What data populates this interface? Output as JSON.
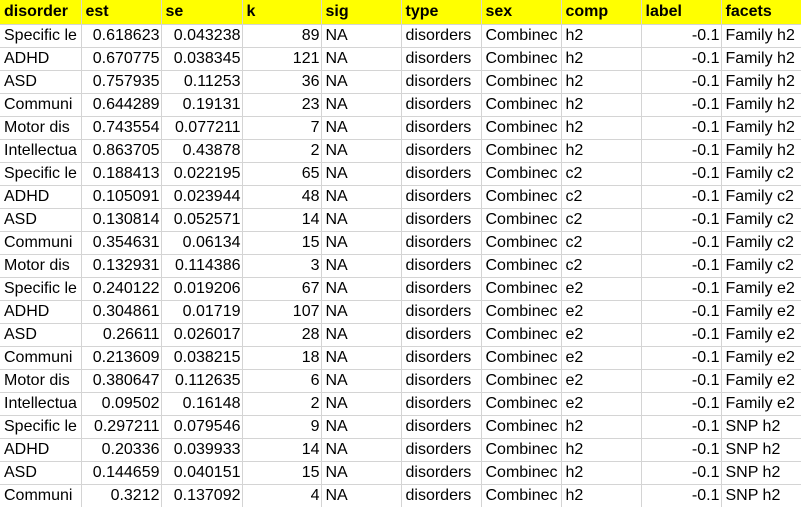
{
  "colors": {
    "header_bg": "#ffff00",
    "gridline": "#d4d4d4"
  },
  "header": {
    "disorder": "disorder",
    "est": "est",
    "se": "se",
    "k": "k",
    "sig": "sig",
    "type": "type",
    "sex": "sex",
    "comp": "comp",
    "label": "label",
    "facets": "facets"
  },
  "rows": [
    {
      "disorder": "Specific le",
      "est": "0.618623",
      "se": "0.043238",
      "k": "89",
      "sig": "NA",
      "type": "disorders",
      "sex": "Combinec",
      "comp": "h2",
      "label": "-0.1",
      "facets": "Family h2"
    },
    {
      "disorder": "ADHD",
      "est": "0.670775",
      "se": "0.038345",
      "k": "121",
      "sig": "NA",
      "type": "disorders",
      "sex": "Combinec",
      "comp": "h2",
      "label": "-0.1",
      "facets": "Family h2"
    },
    {
      "disorder": "ASD",
      "est": "0.757935",
      "se": "0.11253",
      "k": "36",
      "sig": "NA",
      "type": "disorders",
      "sex": "Combinec",
      "comp": "h2",
      "label": "-0.1",
      "facets": "Family h2"
    },
    {
      "disorder": "Communi",
      "est": "0.644289",
      "se": "0.19131",
      "k": "23",
      "sig": "NA",
      "type": "disorders",
      "sex": "Combinec",
      "comp": "h2",
      "label": "-0.1",
      "facets": "Family h2"
    },
    {
      "disorder": "Motor dis",
      "est": "0.743554",
      "se": "0.077211",
      "k": "7",
      "sig": "NA",
      "type": "disorders",
      "sex": "Combinec",
      "comp": "h2",
      "label": "-0.1",
      "facets": "Family h2"
    },
    {
      "disorder": "Intellectua",
      "est": "0.863705",
      "se": "0.43878",
      "k": "2",
      "sig": "NA",
      "type": "disorders",
      "sex": "Combinec",
      "comp": "h2",
      "label": "-0.1",
      "facets": "Family h2"
    },
    {
      "disorder": "Specific le",
      "est": "0.188413",
      "se": "0.022195",
      "k": "65",
      "sig": "NA",
      "type": "disorders",
      "sex": "Combinec",
      "comp": "c2",
      "label": "-0.1",
      "facets": "Family c2"
    },
    {
      "disorder": "ADHD",
      "est": "0.105091",
      "se": "0.023944",
      "k": "48",
      "sig": "NA",
      "type": "disorders",
      "sex": "Combinec",
      "comp": "c2",
      "label": "-0.1",
      "facets": "Family c2"
    },
    {
      "disorder": "ASD",
      "est": "0.130814",
      "se": "0.052571",
      "k": "14",
      "sig": "NA",
      "type": "disorders",
      "sex": "Combinec",
      "comp": "c2",
      "label": "-0.1",
      "facets": "Family c2"
    },
    {
      "disorder": "Communi",
      "est": "0.354631",
      "se": "0.06134",
      "k": "15",
      "sig": "NA",
      "type": "disorders",
      "sex": "Combinec",
      "comp": "c2",
      "label": "-0.1",
      "facets": "Family c2"
    },
    {
      "disorder": "Motor dis",
      "est": "0.132931",
      "se": "0.114386",
      "k": "3",
      "sig": "NA",
      "type": "disorders",
      "sex": "Combinec",
      "comp": "c2",
      "label": "-0.1",
      "facets": "Family c2"
    },
    {
      "disorder": "Specific le",
      "est": "0.240122",
      "se": "0.019206",
      "k": "67",
      "sig": "NA",
      "type": "disorders",
      "sex": "Combinec",
      "comp": "e2",
      "label": "-0.1",
      "facets": "Family e2"
    },
    {
      "disorder": "ADHD",
      "est": "0.304861",
      "se": "0.01719",
      "k": "107",
      "sig": "NA",
      "type": "disorders",
      "sex": "Combinec",
      "comp": "e2",
      "label": "-0.1",
      "facets": "Family e2"
    },
    {
      "disorder": "ASD",
      "est": "0.26611",
      "se": "0.026017",
      "k": "28",
      "sig": "NA",
      "type": "disorders",
      "sex": "Combinec",
      "comp": "e2",
      "label": "-0.1",
      "facets": "Family e2"
    },
    {
      "disorder": "Communi",
      "est": "0.213609",
      "se": "0.038215",
      "k": "18",
      "sig": "NA",
      "type": "disorders",
      "sex": "Combinec",
      "comp": "e2",
      "label": "-0.1",
      "facets": "Family e2"
    },
    {
      "disorder": "Motor dis",
      "est": "0.380647",
      "se": "0.112635",
      "k": "6",
      "sig": "NA",
      "type": "disorders",
      "sex": "Combinec",
      "comp": "e2",
      "label": "-0.1",
      "facets": "Family e2"
    },
    {
      "disorder": "Intellectua",
      "est": "0.09502",
      "se": "0.16148",
      "k": "2",
      "sig": "NA",
      "type": "disorders",
      "sex": "Combinec",
      "comp": "e2",
      "label": "-0.1",
      "facets": "Family e2"
    },
    {
      "disorder": "Specific le",
      "est": "0.297211",
      "se": "0.079546",
      "k": "9",
      "sig": "NA",
      "type": "disorders",
      "sex": "Combinec",
      "comp": "h2",
      "label": "-0.1",
      "facets": "SNP h2"
    },
    {
      "disorder": "ADHD",
      "est": "0.20336",
      "se": "0.039933",
      "k": "14",
      "sig": "NA",
      "type": "disorders",
      "sex": "Combinec",
      "comp": "h2",
      "label": "-0.1",
      "facets": "SNP h2"
    },
    {
      "disorder": "ASD",
      "est": "0.144659",
      "se": "0.040151",
      "k": "15",
      "sig": "NA",
      "type": "disorders",
      "sex": "Combinec",
      "comp": "h2",
      "label": "-0.1",
      "facets": "SNP h2"
    },
    {
      "disorder": "Communi",
      "est": "0.3212",
      "se": "0.137092",
      "k": "4",
      "sig": "NA",
      "type": "disorders",
      "sex": "Combinec",
      "comp": "h2",
      "label": "-0.1",
      "facets": "SNP h2"
    }
  ]
}
